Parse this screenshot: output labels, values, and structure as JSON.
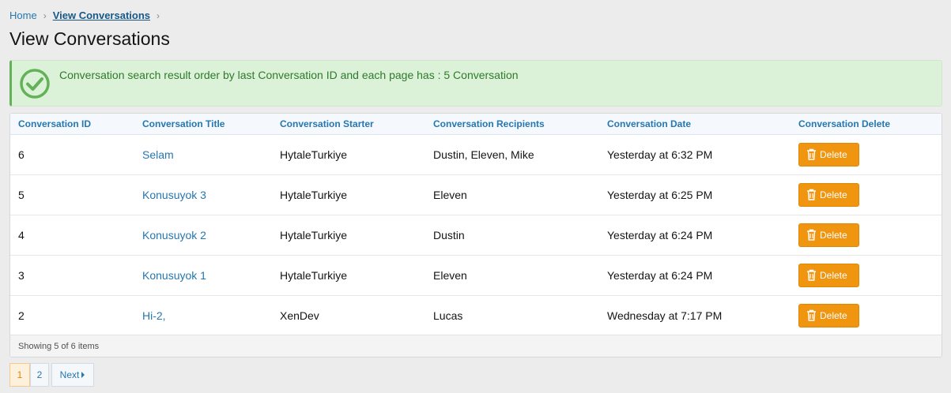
{
  "breadcrumb": {
    "home": "Home",
    "current": "View Conversations",
    "sep": "›"
  },
  "page_title": "View Conversations",
  "alert": {
    "message": "Conversation search result order by last Conversation ID and each page has : 5 Conversation",
    "icon": "check-circle-icon",
    "color": "#63b257"
  },
  "table": {
    "headers": [
      "Conversation ID",
      "Conversation Title",
      "Conversation Starter",
      "Conversation Recipients",
      "Conversation Date",
      "Conversation Delete"
    ],
    "rows": [
      {
        "id": "6",
        "title": "Selam",
        "starter": "HytaleTurkiye",
        "recipients": "Dustin, Eleven, Mike",
        "date": "Yesterday at 6:32 PM",
        "delete": "Delete"
      },
      {
        "id": "5",
        "title": "Konusuyok 3",
        "starter": "HytaleTurkiye",
        "recipients": "Eleven",
        "date": "Yesterday at 6:25 PM",
        "delete": "Delete"
      },
      {
        "id": "4",
        "title": "Konusuyok 2",
        "starter": "HytaleTurkiye",
        "recipients": "Dustin",
        "date": "Yesterday at 6:24 PM",
        "delete": "Delete"
      },
      {
        "id": "3",
        "title": "Konusuyok 1",
        "starter": "HytaleTurkiye",
        "recipients": "Eleven",
        "date": "Yesterday at 6:24 PM",
        "delete": "Delete"
      },
      {
        "id": "2",
        "title": "Hi-2,",
        "starter": "XenDev",
        "recipients": "Lucas",
        "date": "Wednesday at 7:17 PM",
        "delete": "Delete"
      }
    ],
    "footer": "Showing 5 of 6 items"
  },
  "pagination": {
    "pages": [
      "1",
      "2"
    ],
    "current": "1",
    "next": "Next"
  },
  "colors": {
    "accent": "#2577b1",
    "delete": "#f0950f",
    "success_bg": "#dbf2d8"
  }
}
